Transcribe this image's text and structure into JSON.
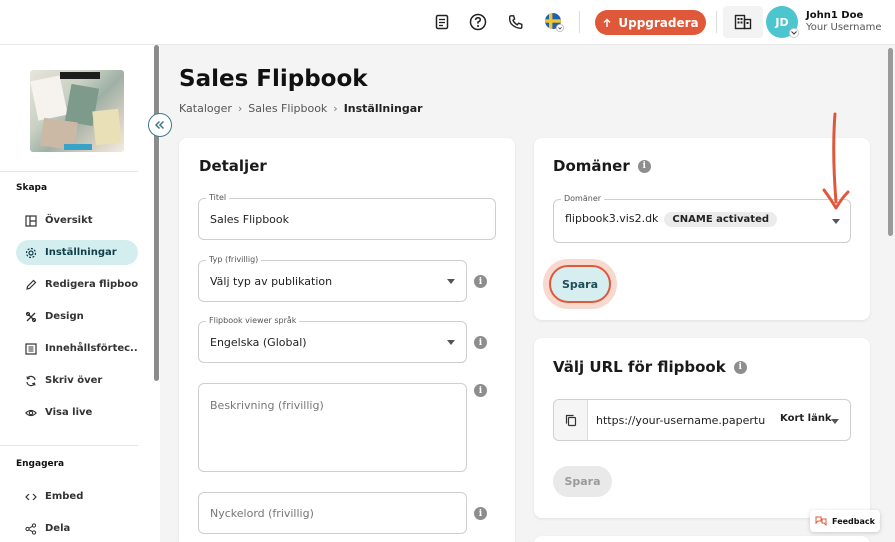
{
  "topbar": {
    "upgrade_label": "Uppgradera",
    "user_name": "John1 Doe",
    "user_subtitle": "Your Username",
    "avatar_initials": "JD",
    "icons": [
      "document-icon",
      "help-icon",
      "phone-icon",
      "sweden-flag-icon",
      "building-icon"
    ]
  },
  "sidebar": {
    "sections": {
      "create": "Skapa",
      "engage": "Engagera"
    },
    "items": [
      {
        "label": "Översikt",
        "icon": "overview-icon"
      },
      {
        "label": "Inställningar",
        "icon": "settings-icon",
        "active": true
      },
      {
        "label": "Redigera flipbook",
        "icon": "pencil-icon"
      },
      {
        "label": "Design",
        "icon": "design-icon"
      },
      {
        "label": "Innehållsförtec...",
        "icon": "list-icon"
      },
      {
        "label": "Skriv över",
        "icon": "refresh-icon"
      },
      {
        "label": "Visa live",
        "icon": "eye-icon"
      }
    ],
    "engage_items": [
      {
        "label": "Embed",
        "icon": "code-icon"
      },
      {
        "label": "Dela",
        "icon": "share-icon"
      }
    ]
  },
  "main": {
    "title": "Sales Flipbook",
    "breadcrumb": [
      "Kataloger",
      "Sales Flipbook",
      "Inställningar"
    ]
  },
  "details": {
    "heading": "Detaljer",
    "title_label": "Titel",
    "title_value": "Sales Flipbook",
    "type_label": "Typ (frivillig)",
    "type_value": "Välj typ av publikation",
    "language_label": "Flipbook viewer språk",
    "language_value": "Engelska (Global)",
    "description_placeholder": "Beskrivning (frivillig)",
    "keywords_placeholder": "Nyckelord (frivillig)"
  },
  "domains": {
    "heading": "Domäner",
    "field_label": "Domäner",
    "domain_value": "flipbook3.vis2.dk",
    "status_chip": "CNAME activated",
    "save_label": "Spara"
  },
  "url": {
    "heading": "Välj URL för flipbook",
    "url_value": "https://your-username.papertur",
    "type_value": "Kort länk",
    "save_label": "Spara"
  },
  "feedback_label": "Feedback",
  "colors": {
    "accent": "#e0583a",
    "active_item_bg": "#d4eef0",
    "avatar": "#4cc5cf"
  }
}
